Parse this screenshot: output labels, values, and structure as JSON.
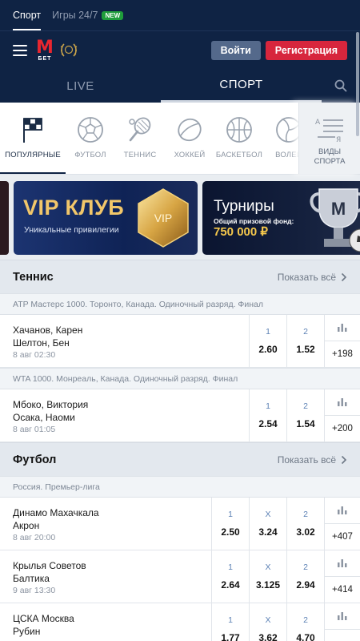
{
  "top_tabs": [
    {
      "label": "Спорт",
      "active": true
    },
    {
      "label": "Игры 24/7",
      "active": false,
      "badge": "NEW"
    }
  ],
  "header": {
    "logo_letter": "M",
    "logo_text": "БЕТ",
    "login_label": "Войти",
    "register_label": "Регистрация"
  },
  "mode_tabs": [
    {
      "label": "LIVE",
      "active": false
    },
    {
      "label": "СПОРТ",
      "active": true
    }
  ],
  "sport_categories": [
    {
      "label": "Популярные",
      "icon": "flag-icon",
      "active": true
    },
    {
      "label": "Футбол",
      "icon": "football-icon"
    },
    {
      "label": "Теннис",
      "icon": "tennis-icon"
    },
    {
      "label": "Хоккей",
      "icon": "hockey-puck-icon"
    },
    {
      "label": "Баскетбол",
      "icon": "basketball-icon"
    },
    {
      "label": "Волей",
      "icon": "volleyball-icon"
    }
  ],
  "sport_types": {
    "label_line1": "Виды",
    "label_line2": "спорта",
    "icon_letter_top": "А",
    "icon_letter_bottom": "Я"
  },
  "banners": {
    "vip": {
      "title": "VIP КЛУБ",
      "subtitle": "Уникальные привилегии",
      "gem_text": "VIP"
    },
    "tournaments": {
      "title": "Турниры",
      "subtitle": "Общий призовой фонд:",
      "prize": "750 000 ₽",
      "cup_letter": "M"
    }
  },
  "sections": [
    {
      "title": "Теннис",
      "show_all": "Показать всё",
      "groups": [
        {
          "league": "ATP Мастерс 1000. Торонто, Канада. Одиночный разряд. Финал",
          "events": [
            {
              "team1": "Хачанов, Карен",
              "team2": "Шелтон, Бен",
              "date": "8 авг 02:30",
              "odds": [
                {
                  "label": "1",
                  "value": "2.60"
                },
                {
                  "label": "2",
                  "value": "1.52"
                }
              ],
              "more": "+198"
            }
          ]
        },
        {
          "league": "WTA 1000. Монреаль, Канада. Одиночный разряд. Финал",
          "events": [
            {
              "team1": "Мбоко, Виктория",
              "team2": "Осака, Наоми",
              "date": "8 авг 01:05",
              "odds": [
                {
                  "label": "1",
                  "value": "2.54"
                },
                {
                  "label": "2",
                  "value": "1.54"
                }
              ],
              "more": "+200"
            }
          ]
        }
      ]
    },
    {
      "title": "Футбол",
      "show_all": "Показать всё",
      "groups": [
        {
          "league": "Россия. Премьер-лига",
          "events": [
            {
              "team1": "Динамо Махачкала",
              "team2": "Акрон",
              "date": "8 авг 20:00",
              "odds": [
                {
                  "label": "1",
                  "value": "2.50"
                },
                {
                  "label": "X",
                  "value": "3.24"
                },
                {
                  "label": "2",
                  "value": "3.02"
                }
              ],
              "more": "+407"
            },
            {
              "team1": "Крылья Советов",
              "team2": "Балтика",
              "date": "9 авг 13:30",
              "odds": [
                {
                  "label": "1",
                  "value": "2.64"
                },
                {
                  "label": "X",
                  "value": "3.125"
                },
                {
                  "label": "2",
                  "value": "2.94"
                }
              ],
              "more": "+414"
            },
            {
              "team1": "ЦСКА Москва",
              "team2": "Рубин",
              "date": "",
              "odds": [
                {
                  "label": "1",
                  "value": "1.77"
                },
                {
                  "label": "X",
                  "value": "3.62"
                },
                {
                  "label": "2",
                  "value": "4.70"
                }
              ],
              "more": ""
            }
          ]
        }
      ]
    }
  ],
  "colors": {
    "brand_dark": "#0f2344",
    "register": "#d7263d",
    "login": "#54698b",
    "accent_gold": "#f2c76a"
  }
}
